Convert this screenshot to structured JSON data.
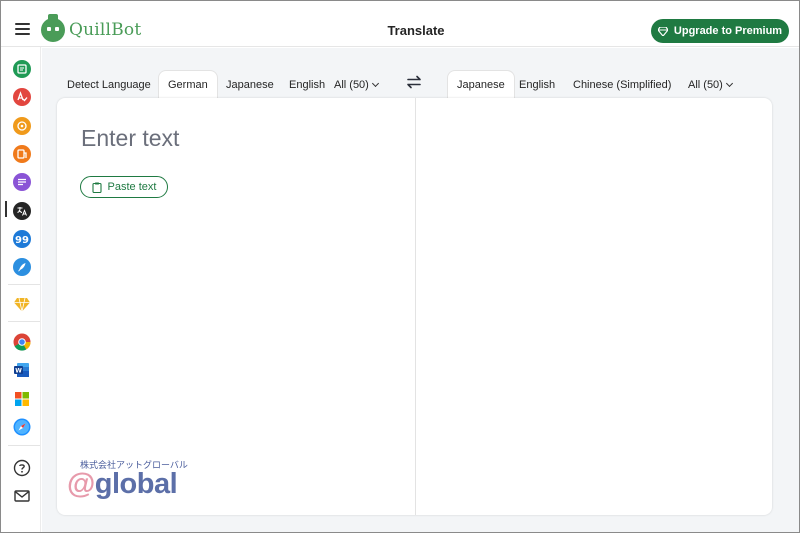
{
  "header": {
    "app_name": "QuillBot",
    "page_title": "Translate",
    "upgrade_label": "Upgrade to Premium"
  },
  "sidebar": {
    "items": [
      {
        "icon": "paraphraser-icon",
        "color": "#1f9a55"
      },
      {
        "icon": "grammar-checker-icon",
        "color": "#e2463f"
      },
      {
        "icon": "ai-detector-icon",
        "color": "#f09a1b"
      },
      {
        "icon": "plagiarism-checker-icon",
        "color": "#f07a1b"
      },
      {
        "icon": "summarizer-icon",
        "color": "#8a54d6"
      },
      {
        "icon": "translator-icon",
        "color": "#252525"
      },
      {
        "icon": "citation-generator-icon",
        "color": "#1d7ad8"
      },
      {
        "icon": "ai-writer-icon",
        "color": "#2c8fe0"
      },
      {
        "icon": "premium-diamond-icon",
        "color": "#f1b526"
      },
      {
        "icon": "chrome-extension-icon",
        "color": "#db4437"
      },
      {
        "icon": "word-addin-icon",
        "color": "#2b579a"
      },
      {
        "icon": "windows-app-icon",
        "color": "#0078d4"
      },
      {
        "icon": "safari-extension-icon",
        "color": "#1e90ff"
      },
      {
        "icon": "help-icon",
        "color": "#333333"
      },
      {
        "icon": "mail-icon",
        "color": "#333333"
      }
    ]
  },
  "source": {
    "tabs": [
      "Detect Language",
      "German",
      "Japanese",
      "English"
    ],
    "active_tab": "German",
    "all_label": "All (50)",
    "placeholder": "Enter text",
    "paste_label": "Paste text"
  },
  "target": {
    "tabs": [
      "Japanese",
      "English",
      "Chinese (Simplified)"
    ],
    "active_tab": "Japanese",
    "all_label": "All (50)"
  },
  "watermark": {
    "company": "株式会社アットグローバル",
    "at": "@",
    "word": "global"
  },
  "colors": {
    "brand_green": "#1f7a42",
    "logo_green": "#4a9c58",
    "background": "#f3f5f7"
  }
}
